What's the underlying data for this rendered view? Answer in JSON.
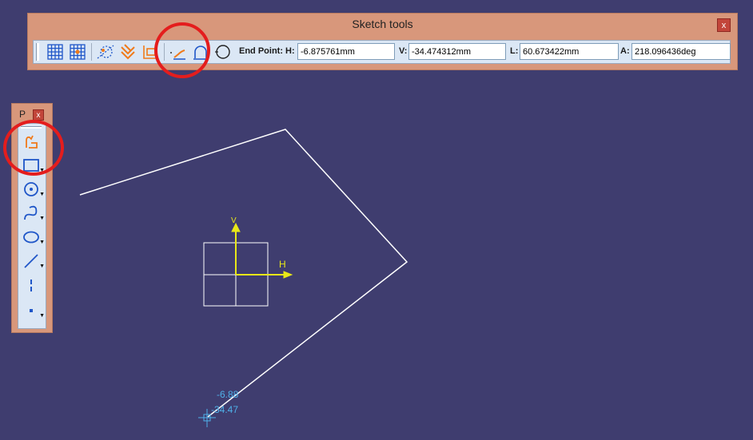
{
  "sketch_tools": {
    "title": "Sketch tools",
    "close": "x",
    "endpoint_label": "End Point: H:",
    "v_label": "V:",
    "l_label": "L:",
    "a_label": "A:",
    "h_value": "-6.875761mm",
    "v_value": "-34.474312mm",
    "l_value": "60.673422mm",
    "a_value": "218.096436deg",
    "icons": [
      "grid-icon",
      "snap-to-point-icon",
      "construction-element-icon",
      "geometrical-constraints-icon",
      "dimensional-constraints-icon",
      "tangent-arc-icon",
      "three-point-arc-icon",
      "circle-icon"
    ]
  },
  "profile_palette": {
    "title": "P",
    "close": "x",
    "tools": [
      "profile-tool-icon",
      "rectangle-icon",
      "circle-icon",
      "spline-icon",
      "ellipse-icon",
      "line-icon",
      "axis-icon",
      "point-icon"
    ]
  },
  "canvas": {
    "h_axis_label": "H",
    "v_axis_label": "V",
    "cursor_h": "-6.88",
    "cursor_v": "-34.47"
  },
  "colors": {
    "background": "#3f3d6f",
    "toolbar": "#d8977b",
    "axis": "#e8e818",
    "geometry": "#ffffff",
    "coordinates": "#4fb0e8",
    "annotation": "#e41d1d"
  }
}
